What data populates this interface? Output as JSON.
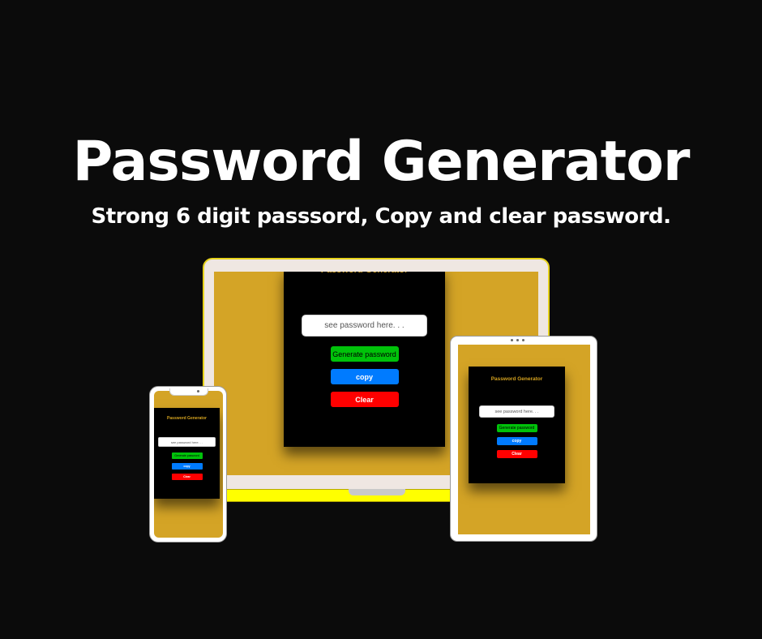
{
  "hero": {
    "title": "Password Generator",
    "subtitle": "Strong 6 digit passsord, Copy and clear password."
  },
  "app": {
    "title": "Password Generator",
    "input_placeholder": "see password here. . .",
    "generate_label": "Generate password",
    "copy_label": "copy",
    "clear_label": "Clear"
  },
  "colors": {
    "background": "#0b0b0b",
    "screen_bg": "#d4a426",
    "card_bg": "#000000",
    "app_title": "#d4a21f",
    "generate": "#00c20a",
    "copy": "#007bff",
    "clear": "#ff0000",
    "laptop_base": "#ffff00"
  }
}
